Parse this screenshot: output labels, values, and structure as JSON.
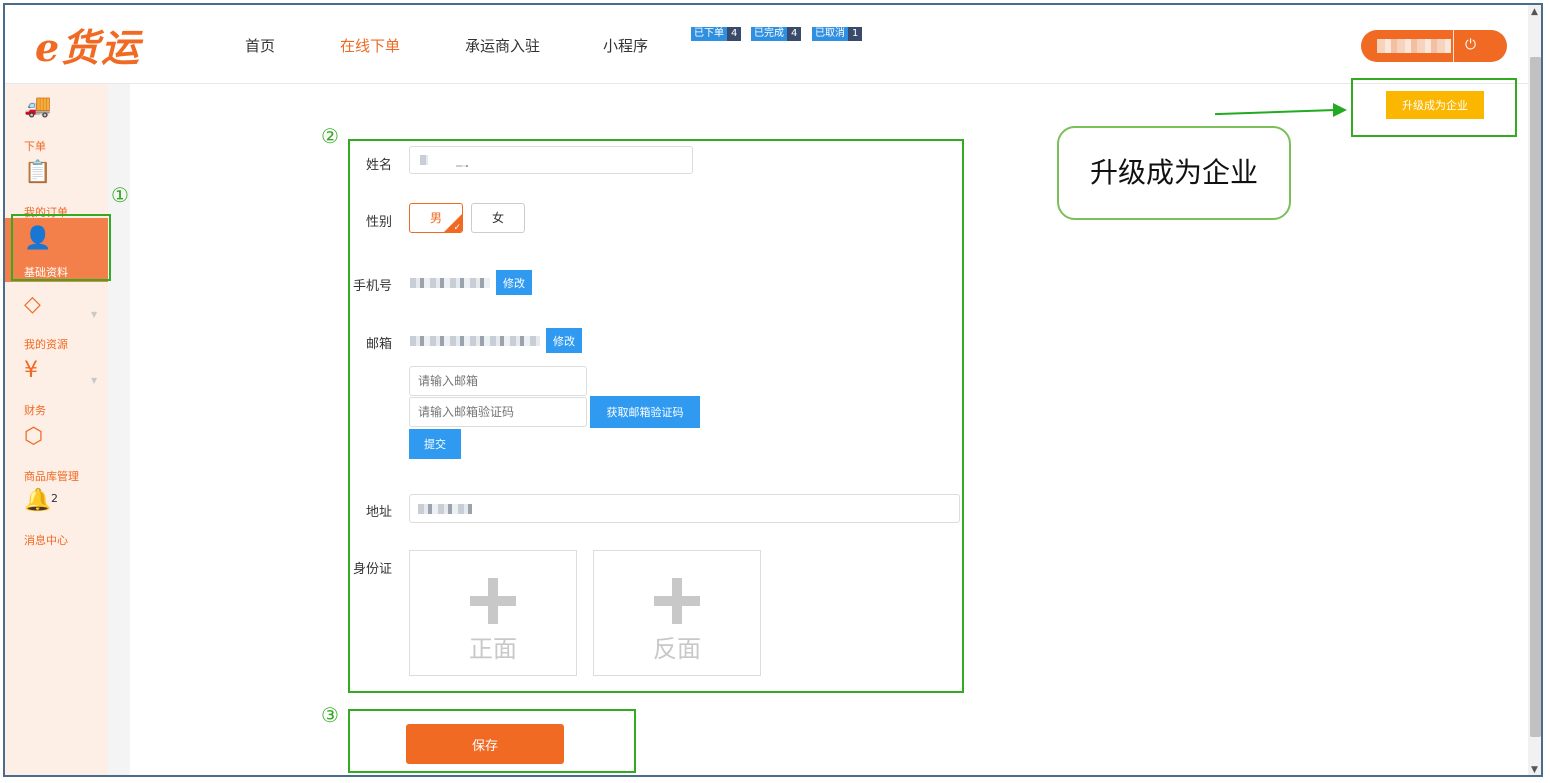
{
  "header": {
    "logo": "e货运",
    "nav": [
      {
        "label": "首页",
        "active": false
      },
      {
        "label": "在线下单",
        "active": true
      },
      {
        "label": "承运商入驻",
        "active": false
      },
      {
        "label": "小程序",
        "active": false
      }
    ],
    "badges": [
      {
        "label": "已下单",
        "count": "4"
      },
      {
        "label": "已完成",
        "count": "4"
      },
      {
        "label": "已取消",
        "count": "1"
      }
    ],
    "power_icon": "⏻"
  },
  "sidebar": {
    "items": [
      {
        "label": "下单",
        "icon": "truck-icon",
        "glyph": "🚚"
      },
      {
        "label": "我的订单",
        "icon": "clipboard-icon",
        "glyph": "📋"
      },
      {
        "label": "基础资料",
        "icon": "user-icon",
        "glyph": "👤",
        "active": true
      },
      {
        "label": "我的资源",
        "icon": "diamond-icon",
        "glyph": "◇"
      },
      {
        "label": "财务",
        "icon": "yen-icon",
        "glyph": "¥"
      },
      {
        "label": "商品库管理",
        "icon": "box-icon",
        "glyph": "⬡"
      },
      {
        "label": "消息中心",
        "icon": "bell-icon",
        "glyph": "🔔",
        "count": "2"
      }
    ]
  },
  "annotations": {
    "marker1": "①",
    "marker2": "②",
    "marker3": "③",
    "bubble": "升级成为企业"
  },
  "upgrade_button": "升级成为企业",
  "form": {
    "name_label": "姓名",
    "gender_label": "性别",
    "gender_options": [
      "男",
      "女"
    ],
    "phone_label": "手机号",
    "edit_label": "修改",
    "email_label": "邮箱",
    "email_placeholder": "请输入邮箱",
    "code_placeholder": "请输入邮箱验证码",
    "get_code_label": "获取邮箱验证码",
    "submit_label": "提交",
    "address_label": "地址",
    "id_label": "身份证",
    "id_front": "正面",
    "id_back": "反面",
    "save_label": "保存"
  }
}
